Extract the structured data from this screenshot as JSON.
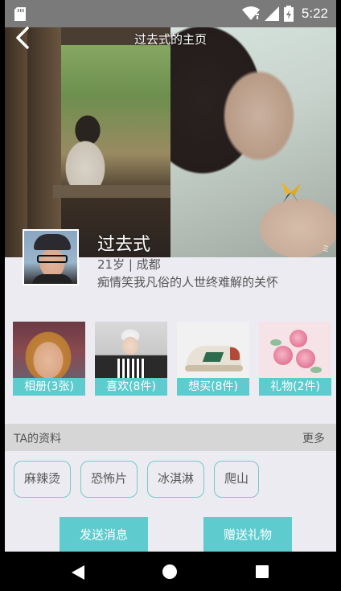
{
  "status_bar": {
    "time": "5:22"
  },
  "header": {
    "title": "过去式的主页"
  },
  "profile": {
    "name": "过去式",
    "meta": "21岁 | 成都",
    "bio": "痴情笑我凡俗的人世终难解的关怀"
  },
  "tiles": [
    {
      "label": "相册(3张)"
    },
    {
      "label": "喜欢(8件)"
    },
    {
      "label": "想买(8件)"
    },
    {
      "label": "礼物(2件)"
    }
  ],
  "info": {
    "title": "TA的资料",
    "more": "更多",
    "tags": [
      "麻辣烫",
      "恐怖片",
      "冰淇淋",
      "爬山"
    ]
  },
  "actions": {
    "send_message": "发送消息",
    "send_gift": "赠送礼物"
  },
  "colors": {
    "accent": "#5ecbcf",
    "background": "#ecebf1",
    "status_bar": "#7a7a7a"
  },
  "icons": [
    "sd-card-icon",
    "wifi-icon",
    "signal-icon",
    "battery-icon",
    "back-arrow-icon",
    "nav-back-icon",
    "nav-home-icon",
    "nav-recent-icon"
  ]
}
